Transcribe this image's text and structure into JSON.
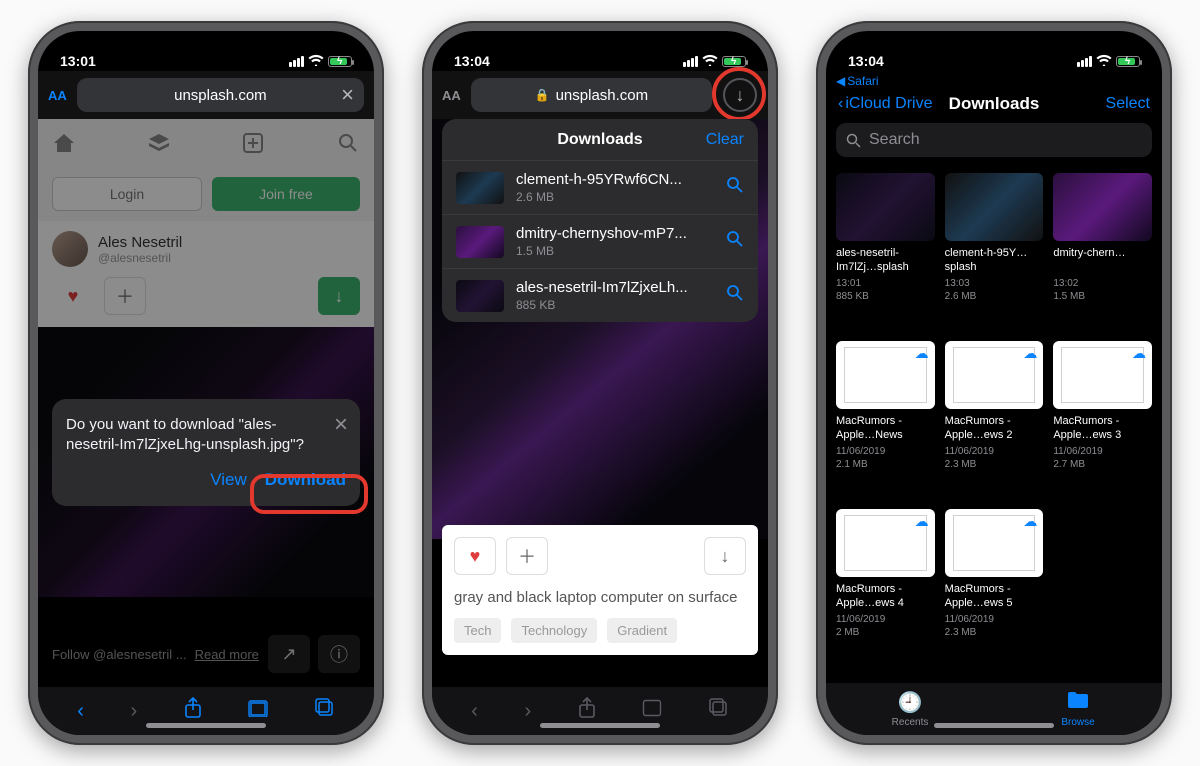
{
  "phone1": {
    "time": "13:01",
    "url": "unsplash.com",
    "login": "Login",
    "join": "Join free",
    "author_name": "Ales Nesetril",
    "author_handle": "@alesnesetril",
    "follow_text": "Follow @alesnesetril ...",
    "read_more": "Read more",
    "prompt_msg": "Do you want to download \"ales-nesetril-Im7lZjxeLhg-unsplash.jpg\"?",
    "prompt_view": "View",
    "prompt_download": "Download"
  },
  "phone2": {
    "time": "13:04",
    "url": "unsplash.com",
    "caption": "gray and black laptop computer on surface",
    "tags": [
      "Tech",
      "Technology",
      "Gradient"
    ],
    "downloads_title": "Downloads",
    "clear": "Clear",
    "items": [
      {
        "name": "clement-h-95YRwf6CN...",
        "size": "2.6 MB"
      },
      {
        "name": "dmitry-chernyshov-mP7...",
        "size": "1.5 MB"
      },
      {
        "name": "ales-nesetril-Im7lZjxeLh...",
        "size": "885 KB"
      }
    ]
  },
  "phone3": {
    "time": "13:04",
    "breadcrumb_app": "Safari",
    "back": "iCloud Drive",
    "title": "Downloads",
    "select": "Select",
    "search_placeholder": "Search",
    "tabs": {
      "recents": "Recents",
      "browse": "Browse"
    },
    "files": [
      {
        "name": "ales-nesetril-Im7lZj…splash",
        "line1": "13:01",
        "line2": "885 KB",
        "thumb": "t3"
      },
      {
        "name": "clement-h-95Y…splash",
        "line1": "13:03",
        "line2": "2.6 MB",
        "thumb": "t1"
      },
      {
        "name": "dmitry-chern…",
        "line1": "13:02",
        "line2": "1.5 MB",
        "thumb": "t2"
      },
      {
        "name": "MacRumors - Apple…News",
        "line1": "11/06/2019",
        "line2": "2.1 MB",
        "thumb": "doc"
      },
      {
        "name": "MacRumors - Apple…ews 2",
        "line1": "11/06/2019",
        "line2": "2.3 MB",
        "thumb": "doc"
      },
      {
        "name": "MacRumors - Apple…ews 3",
        "line1": "11/06/2019",
        "line2": "2.7 MB",
        "thumb": "doc"
      },
      {
        "name": "MacRumors - Apple…ews 4",
        "line1": "11/06/2019",
        "line2": "2 MB",
        "thumb": "doc"
      },
      {
        "name": "MacRumors - Apple…ews 5",
        "line1": "11/06/2019",
        "line2": "2.3 MB",
        "thumb": "doc"
      }
    ]
  }
}
